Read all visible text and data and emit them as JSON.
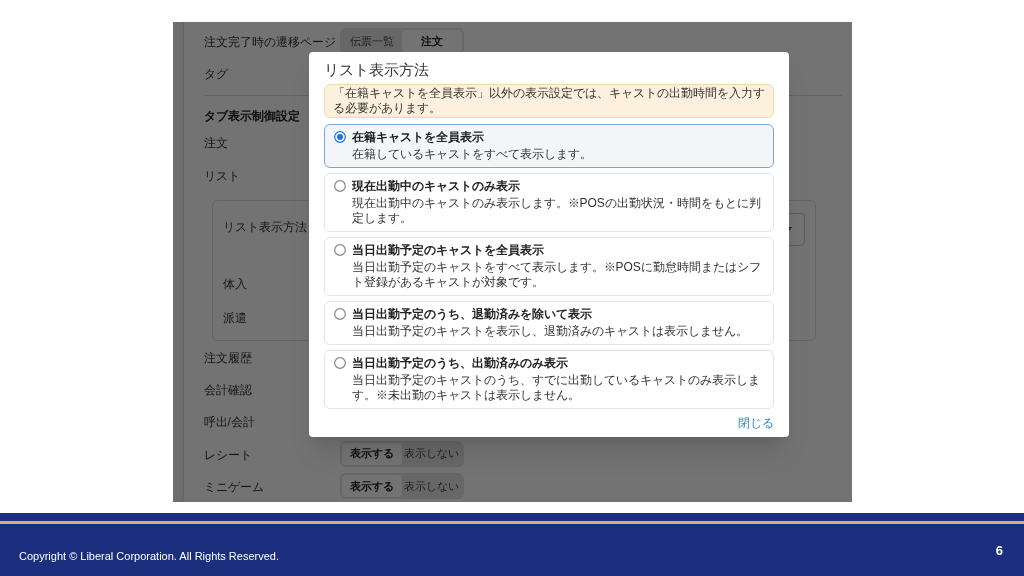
{
  "page": {
    "rows": [
      {
        "kind": "setting",
        "label": "注文完了時の遷移ページ",
        "options": [
          {
            "label": "伝票一覧",
            "selected": false
          },
          {
            "label": "注文",
            "selected": true
          }
        ]
      },
      {
        "kind": "setting",
        "label": "タグ"
      },
      {
        "kind": "heading",
        "label": "タブ表示制御設定"
      },
      {
        "kind": "setting",
        "label": "注文"
      },
      {
        "kind": "setting",
        "label": "リスト"
      },
      {
        "kind": "group",
        "rows": [
          {
            "label": "リスト表示方法",
            "kind": "select"
          },
          {
            "label": "体入"
          },
          {
            "label": "派遣"
          }
        ]
      },
      {
        "kind": "setting",
        "label": "注文履歴"
      },
      {
        "kind": "setting",
        "label": "会計確認"
      },
      {
        "kind": "setting",
        "label": "呼出/会計"
      },
      {
        "kind": "setting",
        "label": "レシート",
        "options": [
          {
            "label": "表示する",
            "selected": true
          },
          {
            "label": "表示しない",
            "selected": false
          }
        ]
      },
      {
        "kind": "setting",
        "label": "ミニゲーム",
        "options": [
          {
            "label": "表示する",
            "selected": true
          },
          {
            "label": "表示しない",
            "selected": false
          }
        ]
      }
    ]
  },
  "dialog": {
    "title": "リスト表示方法",
    "notice": "「在籍キャストを全員表示」以外の表示設定では、キャストの出勤時間を入力する必要があります。",
    "options": [
      {
        "label": "在籍キャストを全員表示",
        "description": "在籍しているキャストをすべて表示します。",
        "selected": true
      },
      {
        "label": "現在出勤中のキャストのみ表示",
        "description": "現在出勤中のキャストのみ表示します。※POSの出勤状況・時間をもとに判定します。",
        "selected": false
      },
      {
        "label": "当日出勤予定のキャストを全員表示",
        "description": "当日出勤予定のキャストをすべて表示します。※POSに勤怠時間またはシフト登録があるキャストが対象です。",
        "selected": false
      },
      {
        "label": "当日出勤予定のうち、退勤済みを除いて表示",
        "description": "当日出勤予定のキャストを表示し、退勤済みのキャストは表示しません。",
        "selected": false
      },
      {
        "label": "当日出勤予定のうち、出勤済みのみ表示",
        "description": "当日出勤予定のキャストのうち、すでに出勤しているキャストのみ表示します。※未出勤のキャストは表示しません。",
        "selected": false
      }
    ],
    "close": "閉じる"
  },
  "footer": {
    "copyright": "Copyright ©  Liberal Corporation. All Rights Reserved.",
    "page_number": "6"
  }
}
